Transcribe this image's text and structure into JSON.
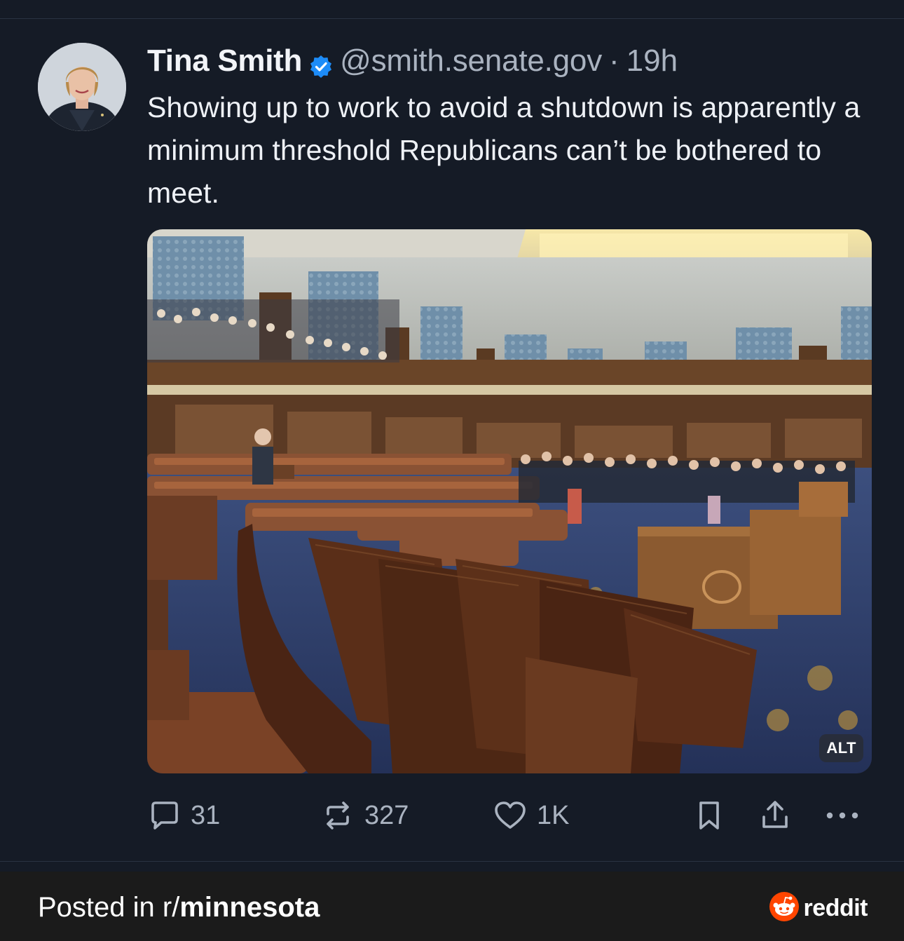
{
  "post": {
    "author": {
      "display_name": "Tina Smith",
      "verified_icon": "verified-badge-icon",
      "handle": "@smith.senate.gov",
      "separator": "·",
      "time": "19h"
    },
    "text": "Showing up to work to avoid a shutdown is apparently a minimum threshold Republicans can’t be bothered to meet.",
    "media": {
      "alt_badge": "ALT"
    },
    "actions": {
      "reply_count": "31",
      "repost_count": "327",
      "like_count": "1K"
    }
  },
  "footer": {
    "prefix": "Posted in r/",
    "subreddit": "minnesota",
    "brand": "reddit"
  },
  "colors": {
    "background": "#151b26",
    "footer_background": "#1b1b1b",
    "secondary_text": "#aab3c0",
    "verified_blue": "#1d8cf8",
    "reddit_orange": "#ff4500"
  }
}
